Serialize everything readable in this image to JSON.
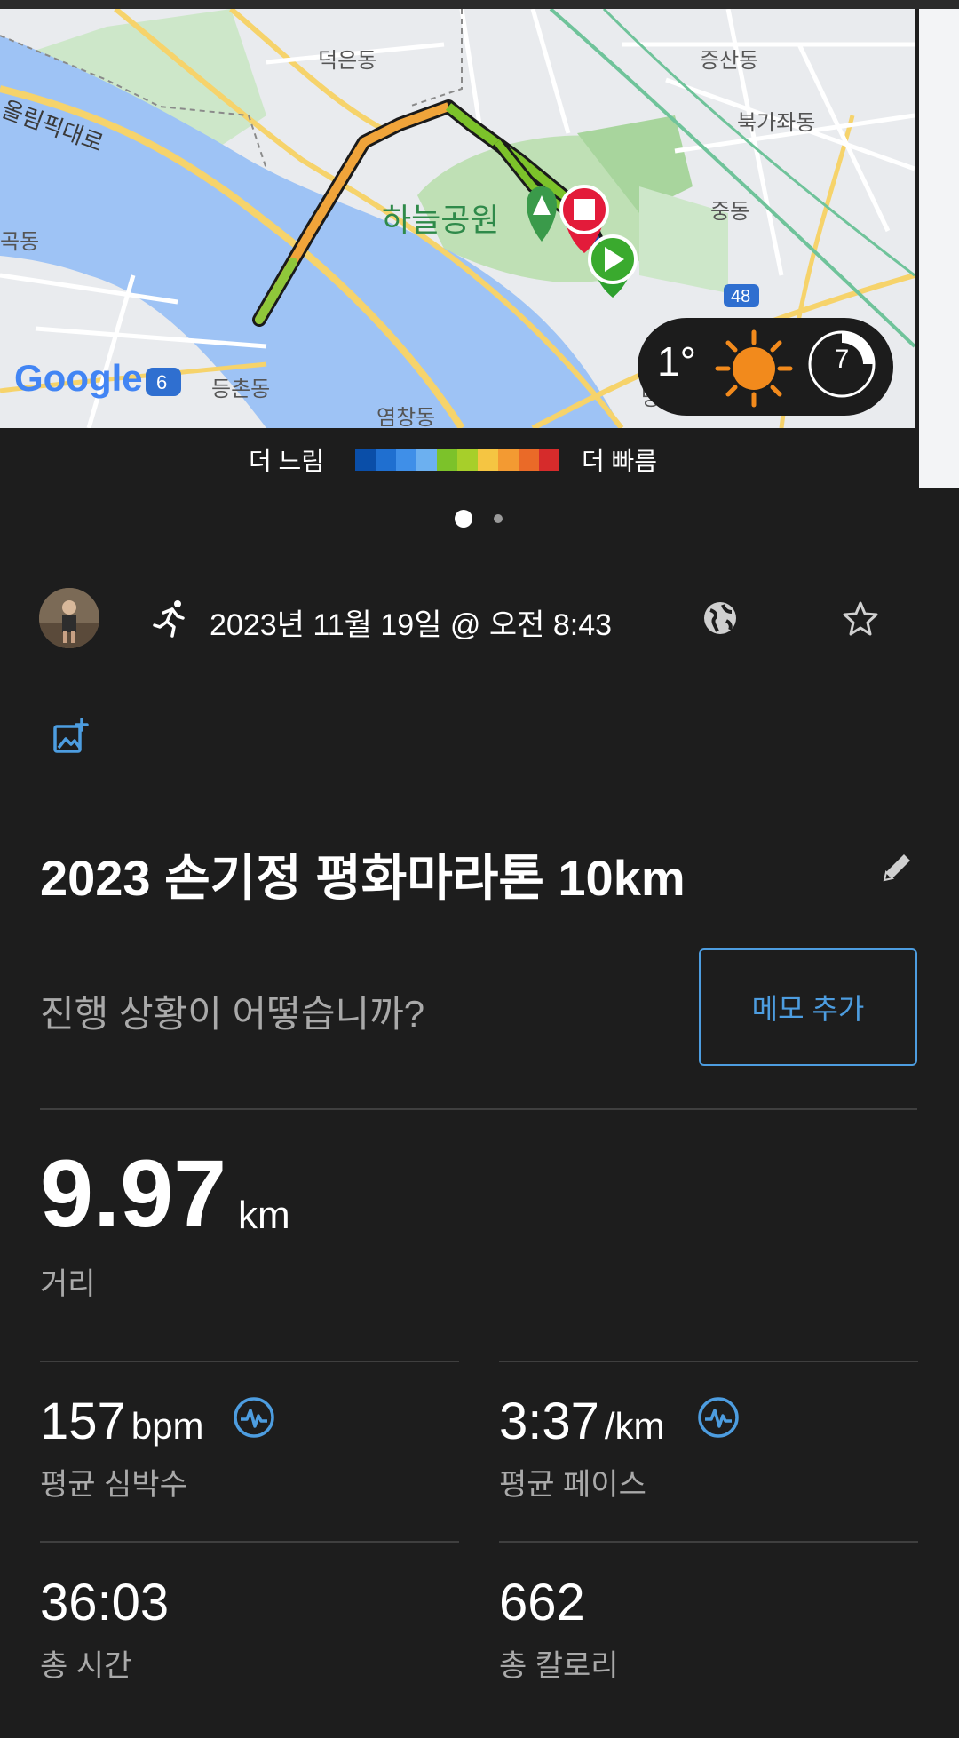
{
  "map": {
    "labels": [
      "덕은동",
      "증산동",
      "북가좌동",
      "올림픽대로",
      "하늘공원",
      "중동",
      "곡동",
      "등촌동",
      "염창동",
      "망원동",
      "Google",
      "6",
      "48"
    ],
    "weather": {
      "temp": "1°",
      "sun_icon": "sun-icon",
      "moon_day": "7"
    }
  },
  "legend": {
    "slow": "더 느림",
    "fast": "더 빠름",
    "colors": [
      "#0a4ea8",
      "#1f6fd0",
      "#3f8fe8",
      "#6cb0f0",
      "#7cc22a",
      "#a7cf2a",
      "#f5c542",
      "#f39a32",
      "#ea6a28",
      "#d62b2b"
    ]
  },
  "pager": {
    "count": 2,
    "active": 0
  },
  "activity": {
    "date": "2023년 11월 19일 @ 오전 8:43",
    "title": "2023 손기정 평화마라톤 10km",
    "prompt": "진행 상황이 어떻습니까?",
    "memo_button": "메모 추가",
    "accent_color": "#4d9de0"
  },
  "stats": {
    "distance": {
      "value": "9.97",
      "unit": "km",
      "label": "거리"
    },
    "heart_rate": {
      "value": "157",
      "unit": "bpm",
      "label": "평균 심박수"
    },
    "pace": {
      "value": "3:37",
      "unit": "/km",
      "label": "평균 페이스"
    },
    "time": {
      "value": "36:03",
      "label": "총 시간"
    },
    "calories": {
      "value": "662",
      "label": "총 칼로리"
    }
  }
}
